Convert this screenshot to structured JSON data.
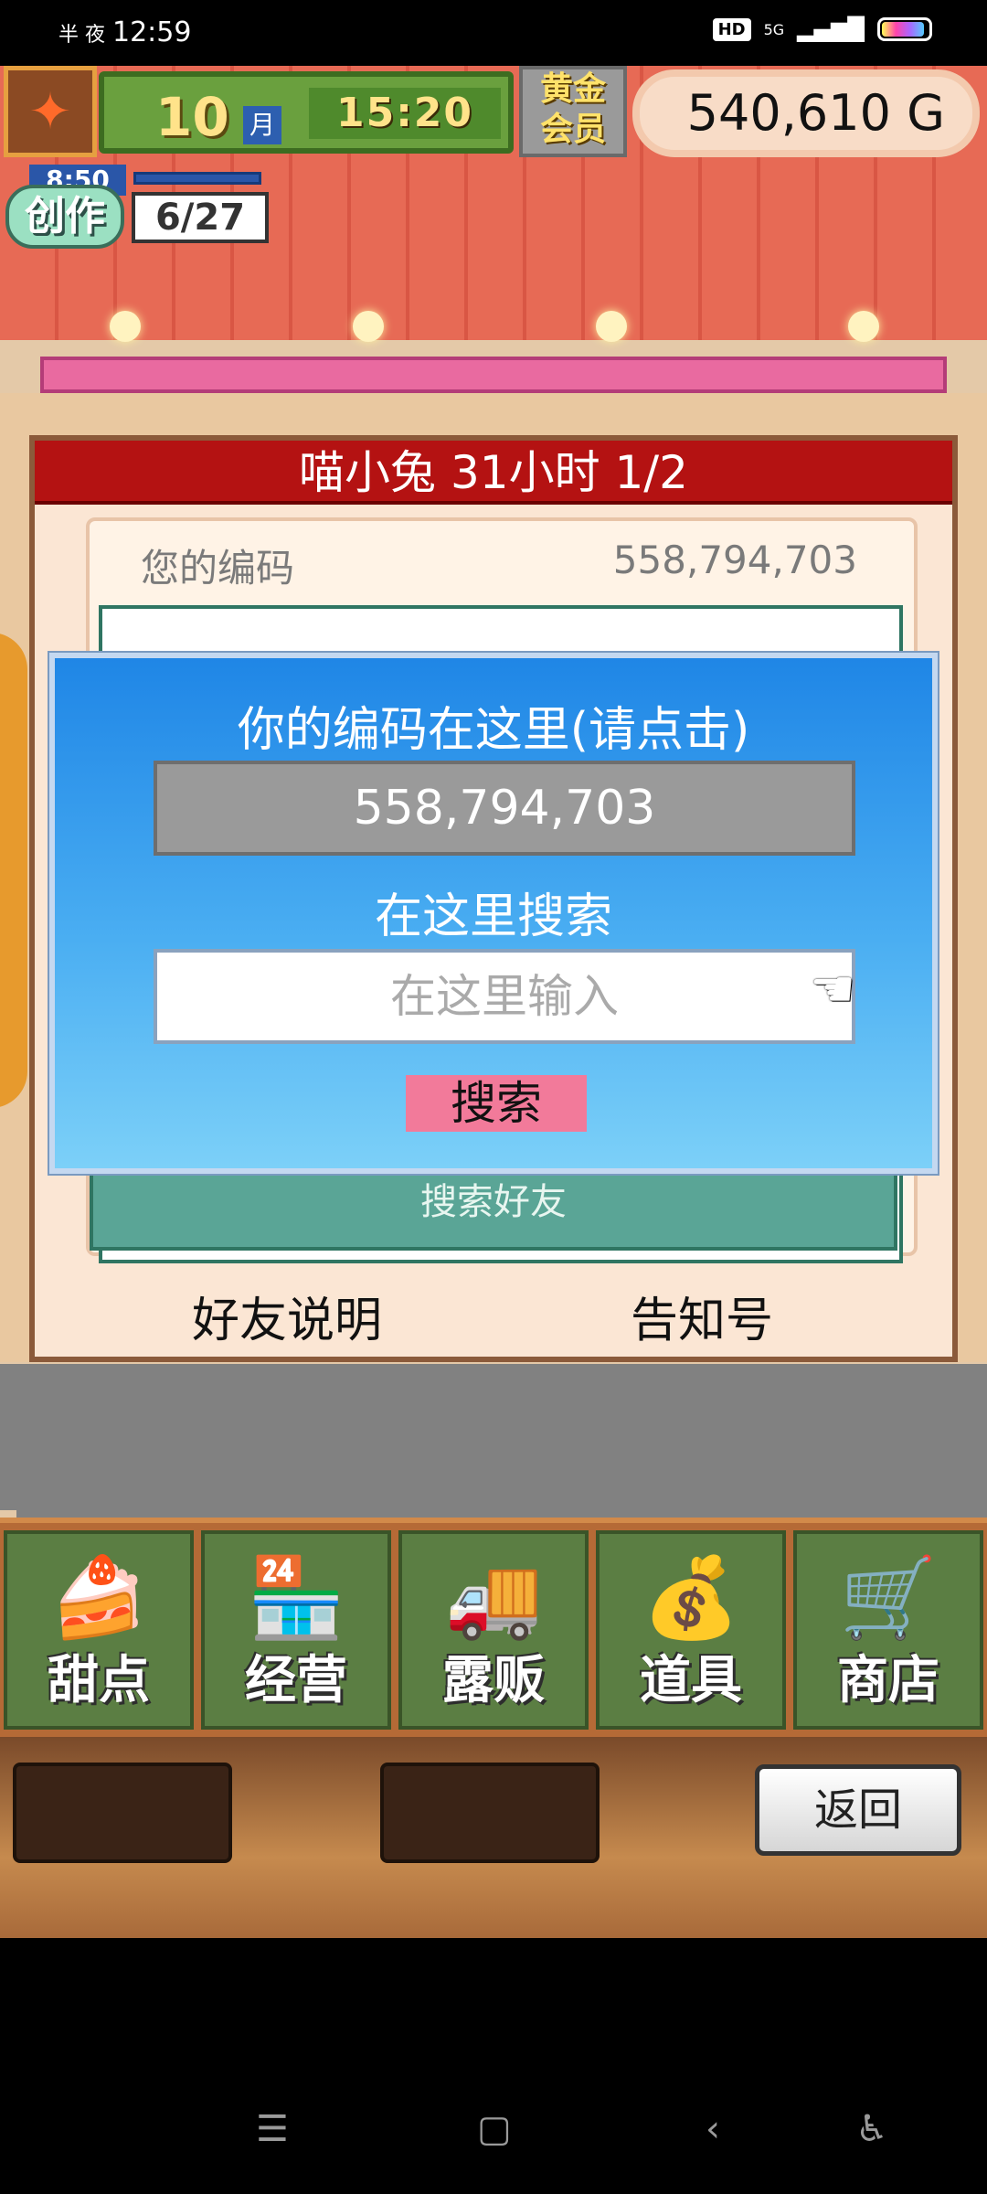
{
  "statusbar": {
    "left_icons": "半 夜",
    "time": "12:59",
    "hd": "HD",
    "network": "5G"
  },
  "hud": {
    "month_value": "10",
    "month_unit": "月",
    "clock": "15:20",
    "membership": "黄金\n会员",
    "membership_line1": "黄金",
    "membership_line2": "会员",
    "money": "540,610 G",
    "create_label": "创作",
    "create_timer": "8:50",
    "create_count": "6/27"
  },
  "panel": {
    "title": "喵小兔 31小时 1/2",
    "code_label": "您的编码",
    "code_value": "558,794,703",
    "search_friend": "搜索好友",
    "footer_left": "好友说明",
    "footer_right": "告知号"
  },
  "dialog": {
    "title": "你的编码在这里(请点击)",
    "code": "558,794,703",
    "search_label": "在这里搜索",
    "input_placeholder": "在这里输入",
    "search_button": "搜索"
  },
  "menu": {
    "items": [
      {
        "label": "甜点",
        "icon": "cake-icon"
      },
      {
        "label": "经营",
        "icon": "shop-icon"
      },
      {
        "label": "露贩",
        "icon": "food-truck-icon"
      },
      {
        "label": "道具",
        "icon": "item-bag-icon"
      },
      {
        "label": "商店",
        "icon": "shopping-cart-icon"
      }
    ]
  },
  "bottombar": {
    "back_label": "返回"
  },
  "colors": {
    "dialog_top": "#1f86e6",
    "dialog_bottom": "#7cd0f8",
    "panel_title_bg": "#b41212",
    "search_button_bg": "#f27a9a"
  }
}
